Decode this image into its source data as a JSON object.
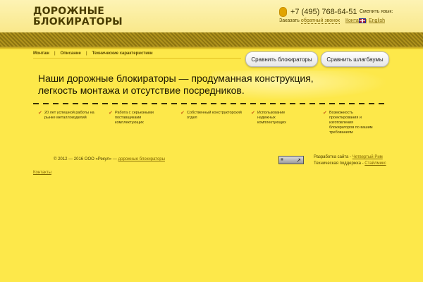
{
  "header": {
    "logo_line1": "ДОРОЖНЫЕ",
    "logo_line2": "БЛОКИРАТОРЫ",
    "phone": "+7 (495) 768-64-51",
    "order_prefix": "Заказать",
    "order_link": "обратный звонок",
    "contacts_link": "Контакты",
    "lang_label": "Сменить язык:",
    "lang_link": "English"
  },
  "nav": {
    "items": [
      "Монтаж",
      "Описание",
      "Технические характеристики"
    ]
  },
  "buttons": {
    "compare_blockers": "Сравнить блокираторы",
    "compare_barriers": "Сравнить шлагбаумы"
  },
  "main": {
    "headline_line1": "Наши дорожные блокираторы — продуманная конструкция,",
    "headline_line2": "легкость монтажа и отсутствие посредников."
  },
  "features": [
    "20 лет успешной работы на рынке металлоизделий",
    "Работа с серьезными поставщиками комплектующих",
    "Собственный конструкторский отдел",
    "Использование надежных комплектующих",
    "Возможность проектирования и изготовления блокираторов по вашим требованиям"
  ],
  "footer": {
    "copyright_text": "© 2012 — 2016 ООО «Рекул» —",
    "copyright_link": "дорожные блокираторы",
    "badge_text": "↗",
    "dev_label": "Разработка сайта -",
    "dev_link": "Четвертый Рим",
    "support_label": "Техническая поддержка -",
    "support_link": "Стайлмикс",
    "contacts_link": "Контакты"
  },
  "colors": {
    "background": "#fde84a",
    "accent_check": "#c8601a",
    "link": "#806600"
  },
  "icons": {
    "phone": "phone-icon",
    "flag": "uk-flag-icon",
    "check": "checkmark-icon"
  }
}
